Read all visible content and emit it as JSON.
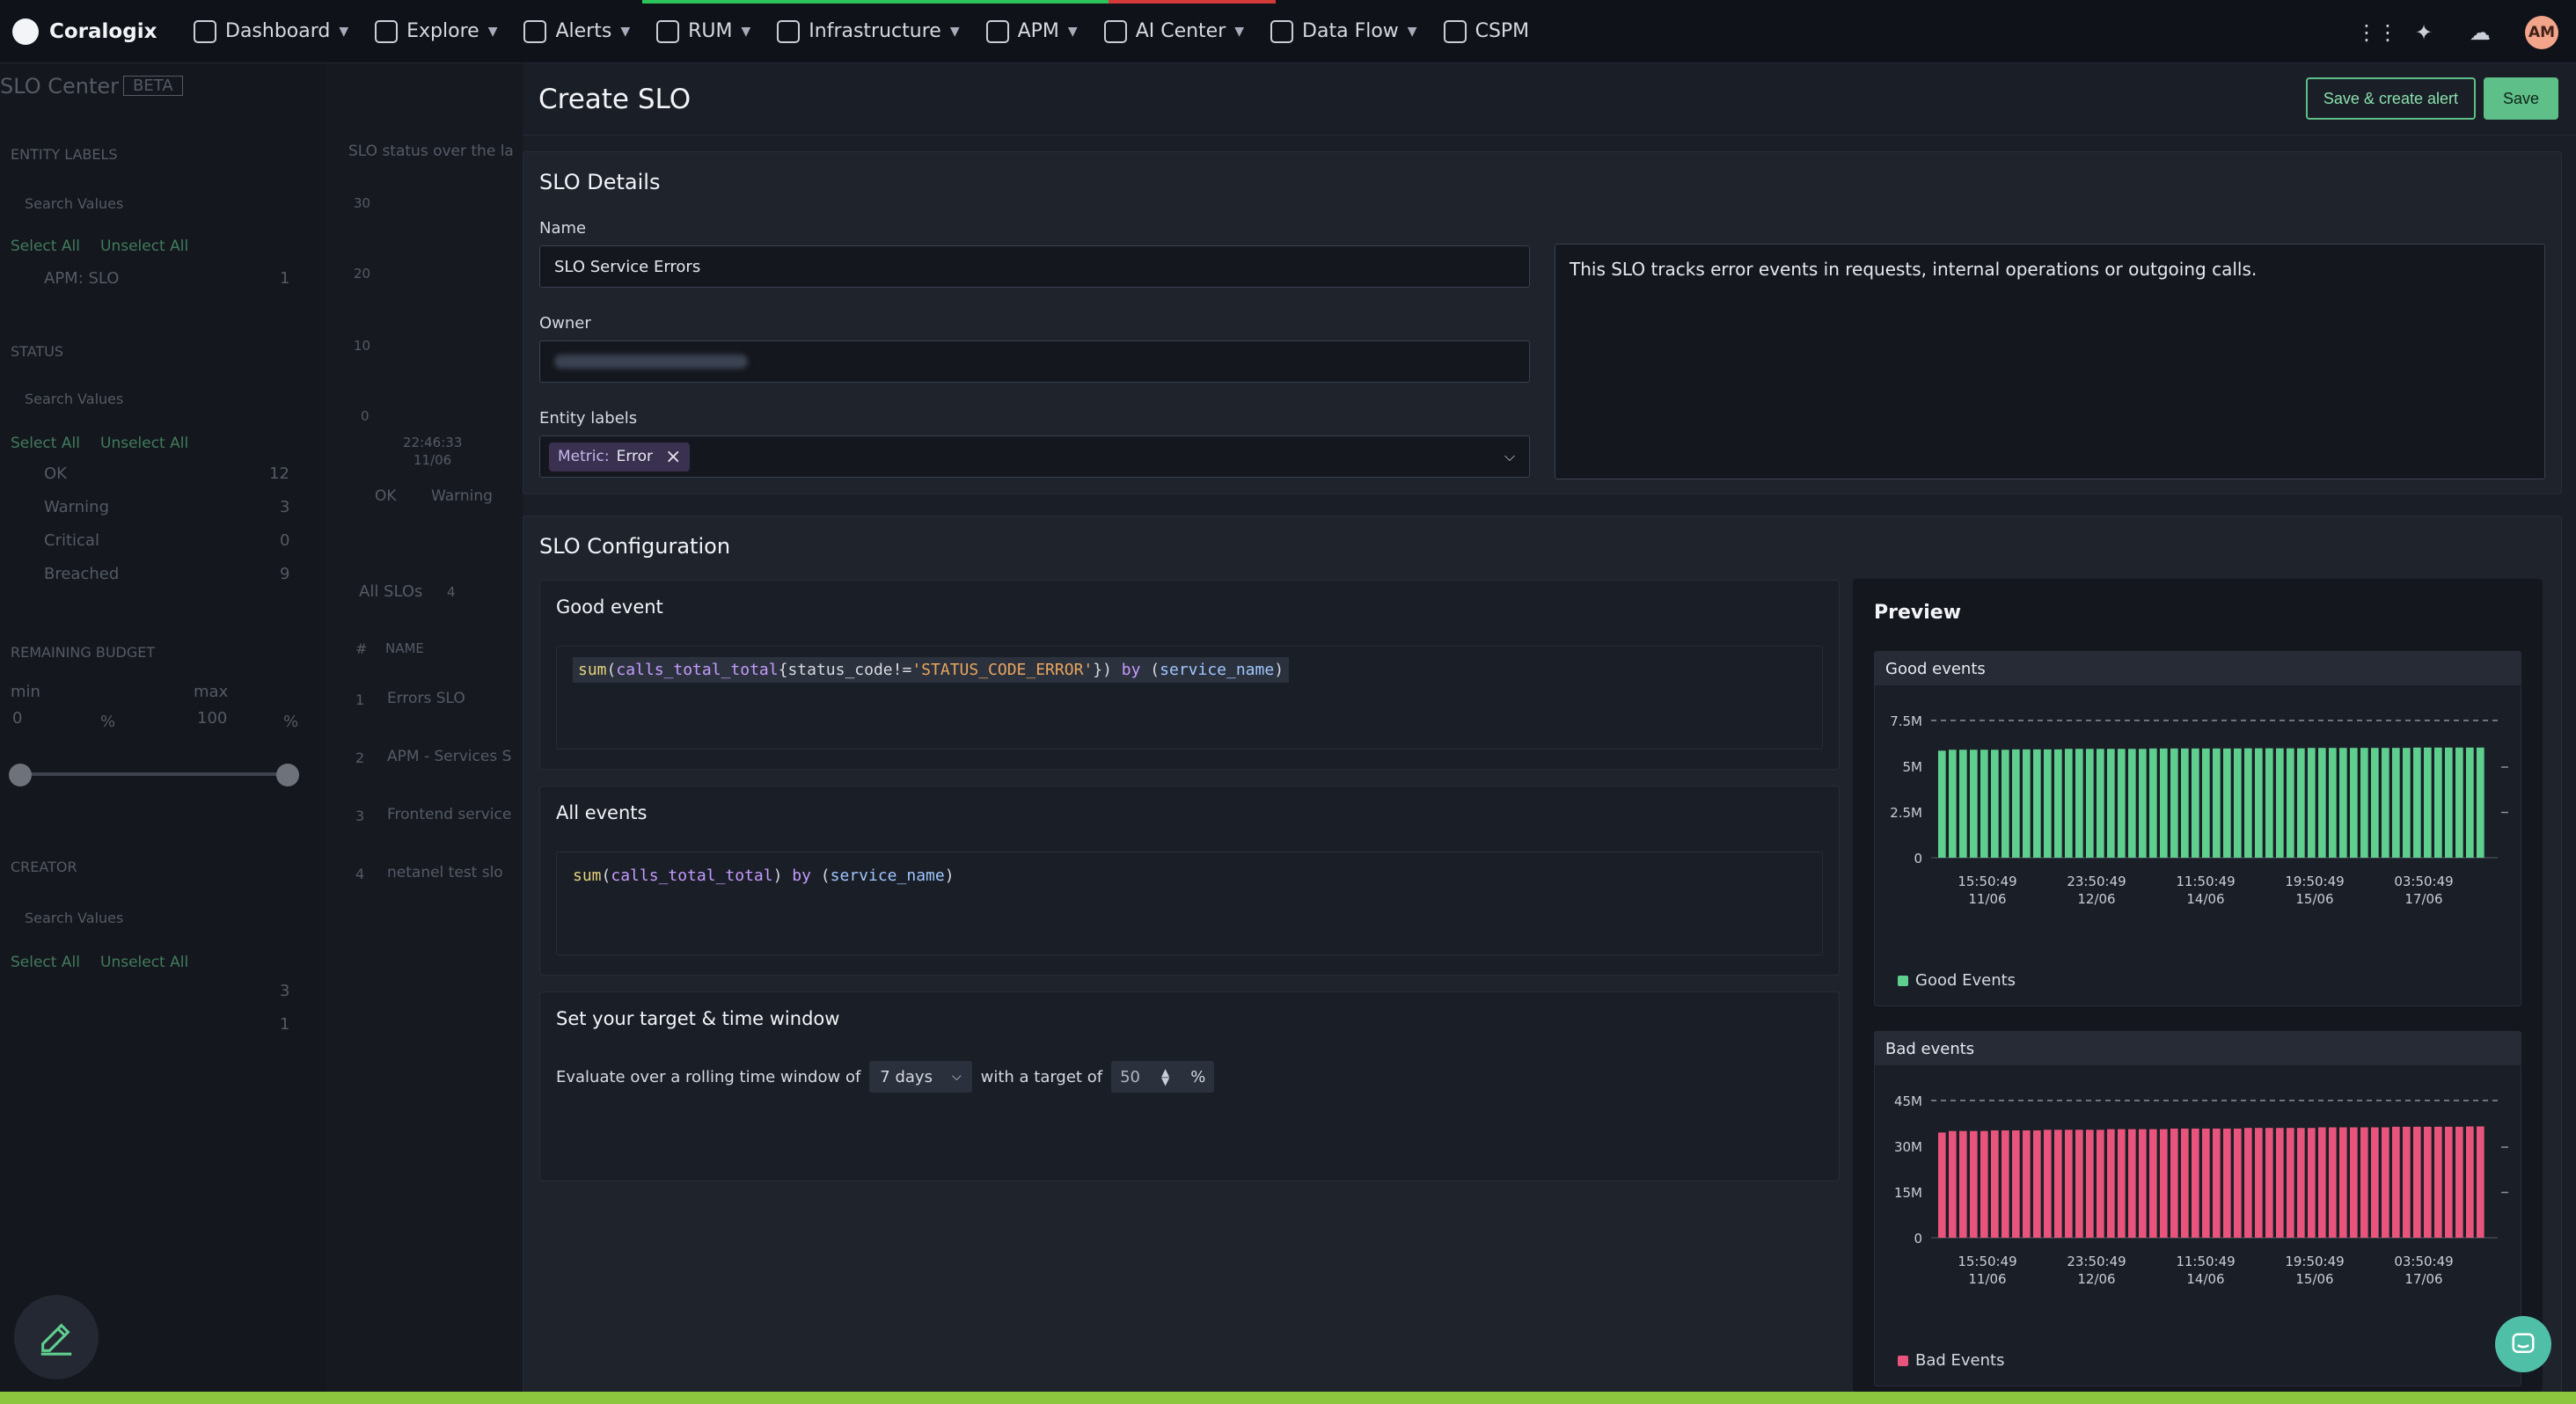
{
  "nav": {
    "brand": "Coralogix",
    "items": [
      {
        "label": "Dashboard",
        "icon": "dashboard-icon"
      },
      {
        "label": "Explore",
        "icon": "explore-icon"
      },
      {
        "label": "Alerts",
        "icon": "bell-icon"
      },
      {
        "label": "RUM",
        "icon": "rum-icon"
      },
      {
        "label": "Infrastructure",
        "icon": "server-icon"
      },
      {
        "label": "APM",
        "icon": "gauge-icon"
      },
      {
        "label": "AI Center",
        "icon": "ai-icon"
      },
      {
        "label": "Data Flow",
        "icon": "flow-icon"
      },
      {
        "label": "CSPM",
        "icon": "shield-icon"
      }
    ],
    "avatar": "AM"
  },
  "background": {
    "title": "SLO Center",
    "badge": "BETA",
    "entity_labels": "ENTITY LABELS",
    "search_placeholder": "Search Values",
    "select_all": "Select All",
    "unselect_all": "Unselect All",
    "apm_slo": "APM: SLO",
    "apm_slo_count": "1",
    "status": "STATUS",
    "statuses": [
      {
        "label": "OK",
        "count": "12"
      },
      {
        "label": "Warning",
        "count": "3"
      },
      {
        "label": "Critical",
        "count": "0"
      },
      {
        "label": "Breached",
        "count": "9"
      }
    ],
    "remaining_budget": "REMAINING BUDGET",
    "min_label": "min",
    "max_label": "max",
    "min_val": "0",
    "max_val": "100",
    "pct": "%",
    "creator": "CREATOR",
    "creator_counts": [
      "3",
      "1"
    ],
    "status_chart_title": "SLO status over the la",
    "y_ticks": [
      "30",
      "20",
      "10",
      "0"
    ],
    "time_label": "22:46:33",
    "date_label": "11/06",
    "legend_ok": "OK",
    "legend_warning": "Warning",
    "all_slos": "All SLOs",
    "all_slos_count": "4",
    "hash": "#",
    "name_col": "NAME",
    "slos": [
      {
        "n": "1",
        "name": "Errors SLO"
      },
      {
        "n": "2",
        "name": "APM - Services S"
      },
      {
        "n": "3",
        "name": "Frontend service"
      },
      {
        "n": "4",
        "name": "netanel test slo"
      }
    ]
  },
  "drawer": {
    "title": "Create SLO",
    "save_create_alert": "Save & create alert",
    "save": "Save",
    "details": {
      "heading": "SLO Details",
      "name_label": "Name",
      "name_value": "SLO Service Errors",
      "owner_label": "Owner",
      "entity_labels_label": "Entity labels",
      "chip_key": "Metric:",
      "chip_value": "Error",
      "description": "This SLO tracks error events in requests, internal operations or outgoing calls."
    },
    "config": {
      "heading": "SLO Configuration",
      "good_event": "Good event",
      "good_query": {
        "fn": "sum",
        "metric": "calls_total_total",
        "filter_key": "status_code",
        "op": "!=",
        "filter_val": "'STATUS_CODE_ERROR'",
        "by": "by",
        "group": "service_name"
      },
      "all_events": "All events",
      "all_query": {
        "fn": "sum",
        "metric": "calls_total_total",
        "by": "by",
        "group": "service_name"
      },
      "target_heading": "Set your target & time window",
      "evaluate_text": "Evaluate over a rolling time window of",
      "window": "7 days",
      "with_target": "with a target of",
      "target": "50",
      "pct": "%"
    },
    "preview": {
      "heading": "Preview"
    }
  },
  "chart_data": [
    {
      "type": "bar",
      "title": "Good events",
      "series": [
        {
          "name": "Good Events",
          "values": [
            5.85,
            5.9,
            5.9,
            5.9,
            5.9,
            5.9,
            5.9,
            5.92,
            5.92,
            5.92,
            5.92,
            5.92,
            5.95,
            5.95,
            5.95,
            5.95,
            5.95,
            5.95,
            5.95,
            5.95,
            5.97,
            5.97,
            5.97,
            5.97,
            5.97,
            5.97,
            5.97,
            5.97,
            5.97,
            5.98,
            5.98,
            5.98,
            5.98,
            5.98,
            5.98,
            6.0,
            6.0,
            6.0,
            6.0,
            6.0,
            6.0,
            6.0,
            6.0,
            6.0,
            6.0,
            6.02,
            6.02,
            6.02,
            6.02,
            6.02,
            6.02,
            6.02
          ]
        }
      ],
      "y_ticks": [
        "7.5M",
        "5M",
        "2.5M",
        "0"
      ],
      "ylim": [
        0,
        7.5
      ],
      "threshold": 7.5,
      "x_ticks": [
        [
          "15:50:49",
          "11/06"
        ],
        [
          "23:50:49",
          "12/06"
        ],
        [
          "11:50:49",
          "14/06"
        ],
        [
          "19:50:49",
          "15/06"
        ],
        [
          "03:50:49",
          "17/06"
        ]
      ],
      "color": "#5fcf8f"
    },
    {
      "type": "bar",
      "title": "Bad events",
      "series": [
        {
          "name": "Bad Events",
          "values": [
            34.5,
            35,
            35,
            35,
            35,
            35.2,
            35.2,
            35.2,
            35.2,
            35.2,
            35.4,
            35.4,
            35.4,
            35.4,
            35.4,
            35.4,
            35.6,
            35.6,
            35.6,
            35.6,
            35.6,
            35.6,
            35.8,
            35.8,
            35.8,
            35.8,
            35.8,
            35.8,
            35.8,
            36,
            36,
            36,
            36,
            36,
            36,
            36,
            36.2,
            36.2,
            36.2,
            36.2,
            36.2,
            36.2,
            36.2,
            36.4,
            36.4,
            36.4,
            36.4,
            36.4,
            36.4,
            36.4,
            36.5,
            36.5
          ]
        }
      ],
      "y_ticks": [
        "45M",
        "30M",
        "15M",
        "0"
      ],
      "ylim": [
        0,
        45
      ],
      "threshold": 45,
      "x_ticks": [
        [
          "15:50:49",
          "11/06"
        ],
        [
          "23:50:49",
          "12/06"
        ],
        [
          "11:50:49",
          "14/06"
        ],
        [
          "19:50:49",
          "15/06"
        ],
        [
          "03:50:49",
          "17/06"
        ]
      ],
      "color": "#e8547c"
    }
  ]
}
